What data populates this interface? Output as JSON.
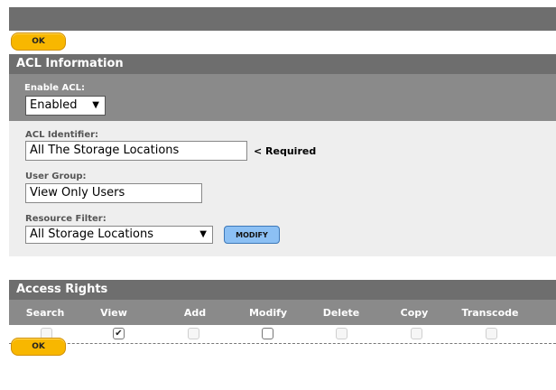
{
  "buttons": {
    "ok_top": "OK",
    "ok_bottom": "OK",
    "modify": "MODIFY"
  },
  "acl_section": {
    "title": "ACL Information",
    "enable_label": "Enable ACL:",
    "enable_value": "Enabled",
    "identifier_label": "ACL Identifier:",
    "identifier_value": "All The Storage Locations",
    "required_note": "< Required",
    "user_group_label": "User Group:",
    "user_group_value": "View Only Users",
    "resource_filter_label": "Resource Filter:",
    "resource_filter_value": "All Storage Locations"
  },
  "access_rights": {
    "title": "Access Rights",
    "columns": [
      "Search",
      "View",
      "Add",
      "Modify",
      "Delete",
      "Copy",
      "Transcode"
    ],
    "checked": [
      false,
      true,
      false,
      false,
      false,
      false,
      false
    ],
    "enabled": [
      false,
      true,
      false,
      true,
      false,
      false,
      false
    ]
  },
  "icons": {
    "dropdown": "caret-down-icon",
    "check": "check-icon"
  },
  "colors": {
    "header_bg": "#6e6e6e",
    "subpanel_bg": "#8a8a8a",
    "ok_button": "#f8b700",
    "modify_button": "#8cc0f4"
  }
}
